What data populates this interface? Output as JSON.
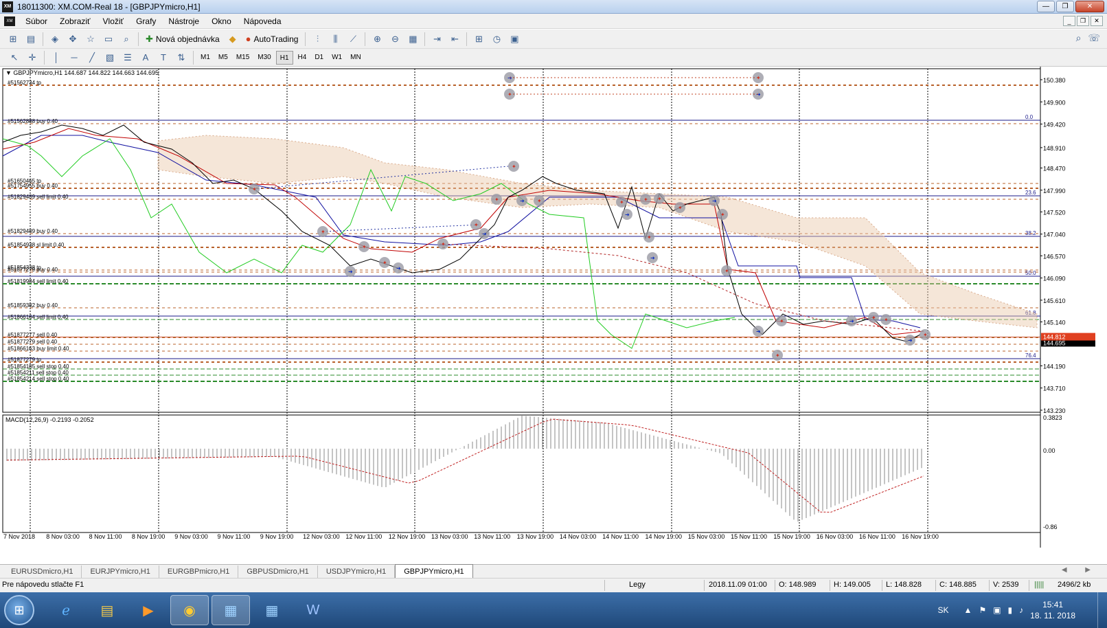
{
  "window": {
    "app_icon": "XM",
    "title": "18011300: XM.COM-Real 18 - [GBPJPYmicro,H1]",
    "min": "—",
    "max": "❐",
    "close": "✕"
  },
  "menu": {
    "icon": "XM",
    "items": [
      "Súbor",
      "Zobraziť",
      "Vložiť",
      "Grafy",
      "Nástroje",
      "Okno",
      "Nápoveda"
    ]
  },
  "toolbar": {
    "new_order": "Nová objednávka",
    "autotrading": "AutoTrading",
    "timeframes": [
      "M1",
      "M5",
      "M15",
      "M30",
      "H1",
      "H4",
      "D1",
      "W1",
      "MN"
    ],
    "active_timeframe": "H1"
  },
  "chart": {
    "header": "GBPJPYmicro,H1  144.687 144.822 144.663 144.695",
    "macd_label": "MACD(12,26,9) -0.2193 -0.2052",
    "price_ticks": [
      "150.380",
      "149.900",
      "149.420",
      "148.910",
      "148.470",
      "147.990",
      "147.520",
      "147.040",
      "146.570",
      "146.090",
      "145.610",
      "145.140",
      "144.695",
      "144.190",
      "143.710",
      "143.230"
    ],
    "current_price": "144.695",
    "bid_line_label": "144.812",
    "macd_ticks": [
      "0.3823",
      "0.00",
      "-0.86"
    ],
    "time_ticks": [
      "7 Nov 2018",
      "8 Nov 03:00",
      "8 Nov 11:00",
      "8 Nov 19:00",
      "9 Nov 03:00",
      "9 Nov 11:00",
      "9 Nov 19:00",
      "12 Nov 03:00",
      "12 Nov 11:00",
      "12 Nov 19:00",
      "13 Nov 03:00",
      "13 Nov 11:00",
      "13 Nov 19:00",
      "14 Nov 03:00",
      "14 Nov 11:00",
      "14 Nov 19:00",
      "15 Nov 03:00",
      "15 Nov 11:00",
      "15 Nov 19:00",
      "16 Nov 03:00",
      "16 Nov 11:00",
      "16 Nov 19:00"
    ],
    "fibo_levels": [
      "0.0",
      "23.6",
      "38.2",
      "50.0",
      "61.8",
      "76.4"
    ],
    "order_labels": [
      "#51562734 tp",
      "#51562888 buy 0.40",
      "#51650465 tp",
      "#51754955 buy 0.40",
      "#51829489 sell limit 0.40",
      "#51829489 buy 0.40",
      "#51854938 sl limit 0.40",
      "#51854338 tp",
      "#51877279 buy 0.40",
      "#51819984 sell limit 0.40",
      "#51859382 buy 0.40",
      "#51866164 sell limit 0.40",
      "#51877277 sell 0.40",
      "#51877279 sell 0.40",
      "#51866163 buy limit 0.40",
      "#51877279 tp",
      "#51854185 sell stop 0.40",
      "#51854211 sell stop 0.40",
      "#51854214 sell stop 0.40"
    ]
  },
  "tabs": [
    "EURUSDmicro,H1",
    "EURJPYmicro,H1",
    "EURGBPmicro,H1",
    "GBPUSDmicro,H1",
    "USDJPYmicro,H1",
    "GBPJPYmicro,H1"
  ],
  "active_tab": "GBPJPYmicro,H1",
  "tab_arrows": "◀ ▶",
  "status": {
    "help": "Pre nápovedu stlačte F1",
    "profile": "Legy",
    "datetime": "2018.11.09 01:00",
    "open": "O: 148.989",
    "high": "H: 149.005",
    "low": "L: 148.828",
    "close": "C: 148.885",
    "volume": "V: 2539",
    "traffic": "2496/2 kb"
  },
  "taskbar": {
    "lang": "SK",
    "time": "15:41",
    "date": "18. 11. 2018"
  },
  "colors": {
    "price_line": "#000000",
    "tenkan": "#c00000",
    "kijun": "#1010a0",
    "chikou": "#22cc22",
    "cloud": "#e8c8a8",
    "order_line": "#b8602a",
    "sell_stop_line": "#2a8a2a",
    "fibo_line": "#1a1a8a"
  }
}
